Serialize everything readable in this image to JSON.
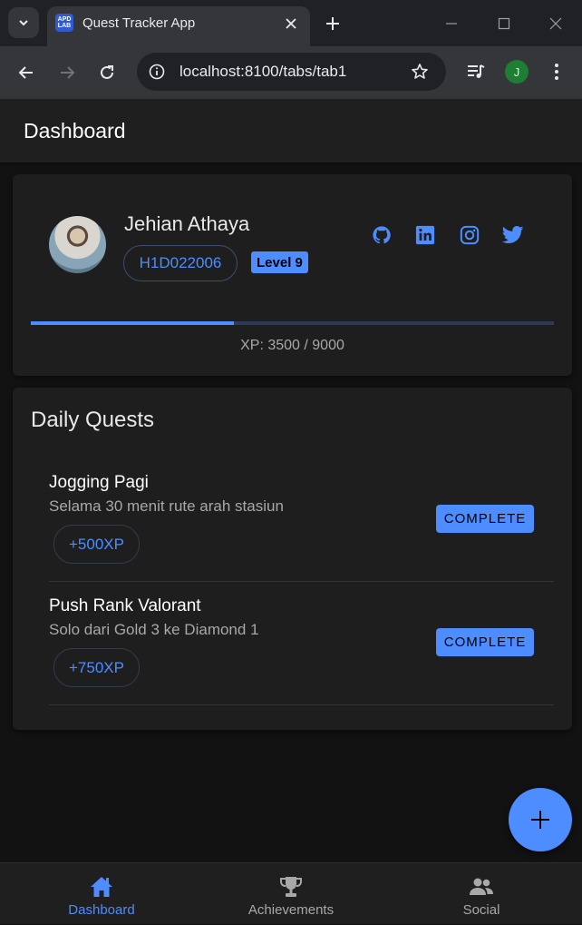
{
  "browser": {
    "tab_title": "Quest Tracker App",
    "favicon_text": "APD LAB",
    "url": "localhost:8100/tabs/tab1",
    "profile_initial": "J"
  },
  "header": {
    "title": "Dashboard"
  },
  "profile": {
    "name": "Jehian Athaya",
    "student_id": "H1D022006",
    "level": "Level 9",
    "social_icons": [
      "github-icon",
      "linkedin-icon",
      "instagram-icon",
      "twitter-icon"
    ],
    "xp_text": "XP: 3500 / 9000",
    "xp_progress": 0.389
  },
  "quests": {
    "title": "Daily Quests",
    "items": [
      {
        "name": "Jogging Pagi",
        "description": "Selama 30 menit rute arah stasiun",
        "xp": "+500XP",
        "action": "COMPLETE"
      },
      {
        "name": "Push Rank Valorant",
        "description": "Solo dari Gold 3 ke Diamond 1",
        "xp": "+750XP",
        "action": "COMPLETE"
      }
    ]
  },
  "tabs": [
    {
      "label": "Dashboard",
      "icon": "home-icon",
      "active": true
    },
    {
      "label": "Achievements",
      "icon": "trophy-icon",
      "active": false
    },
    {
      "label": "Social",
      "icon": "people-icon",
      "active": false
    }
  ],
  "colors": {
    "accent": "#4d8dff",
    "background": "#121212",
    "card": "#1e1e1e"
  }
}
